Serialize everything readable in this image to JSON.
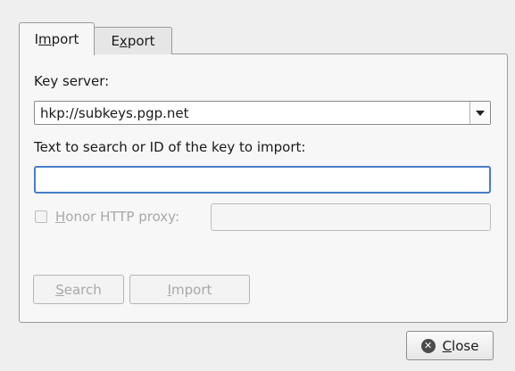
{
  "tabs": [
    {
      "pre": "I",
      "mn": "m",
      "post": "port",
      "selected": true
    },
    {
      "pre": "E",
      "mn": "x",
      "post": "port",
      "selected": false
    }
  ],
  "import_panel": {
    "key_server_label": "Key server:",
    "key_server_value": "hkp://subkeys.pgp.net",
    "search_label": "Text to search or ID of the key to import:",
    "search_value": "",
    "proxy": {
      "checked": false,
      "label_mn": "H",
      "label_rest": "onor HTTP proxy:",
      "value": ""
    },
    "search_button": {
      "mn": "S",
      "rest": "earch"
    },
    "import_button": {
      "mn": "I",
      "rest": "mport"
    }
  },
  "footer": {
    "close_button": {
      "mn": "C",
      "rest": "lose",
      "icon": "close-icon"
    }
  },
  "colors": {
    "focus": "#4a7cc9",
    "window_bg": "#efefef",
    "disabled_text": "#a8a8a8"
  }
}
